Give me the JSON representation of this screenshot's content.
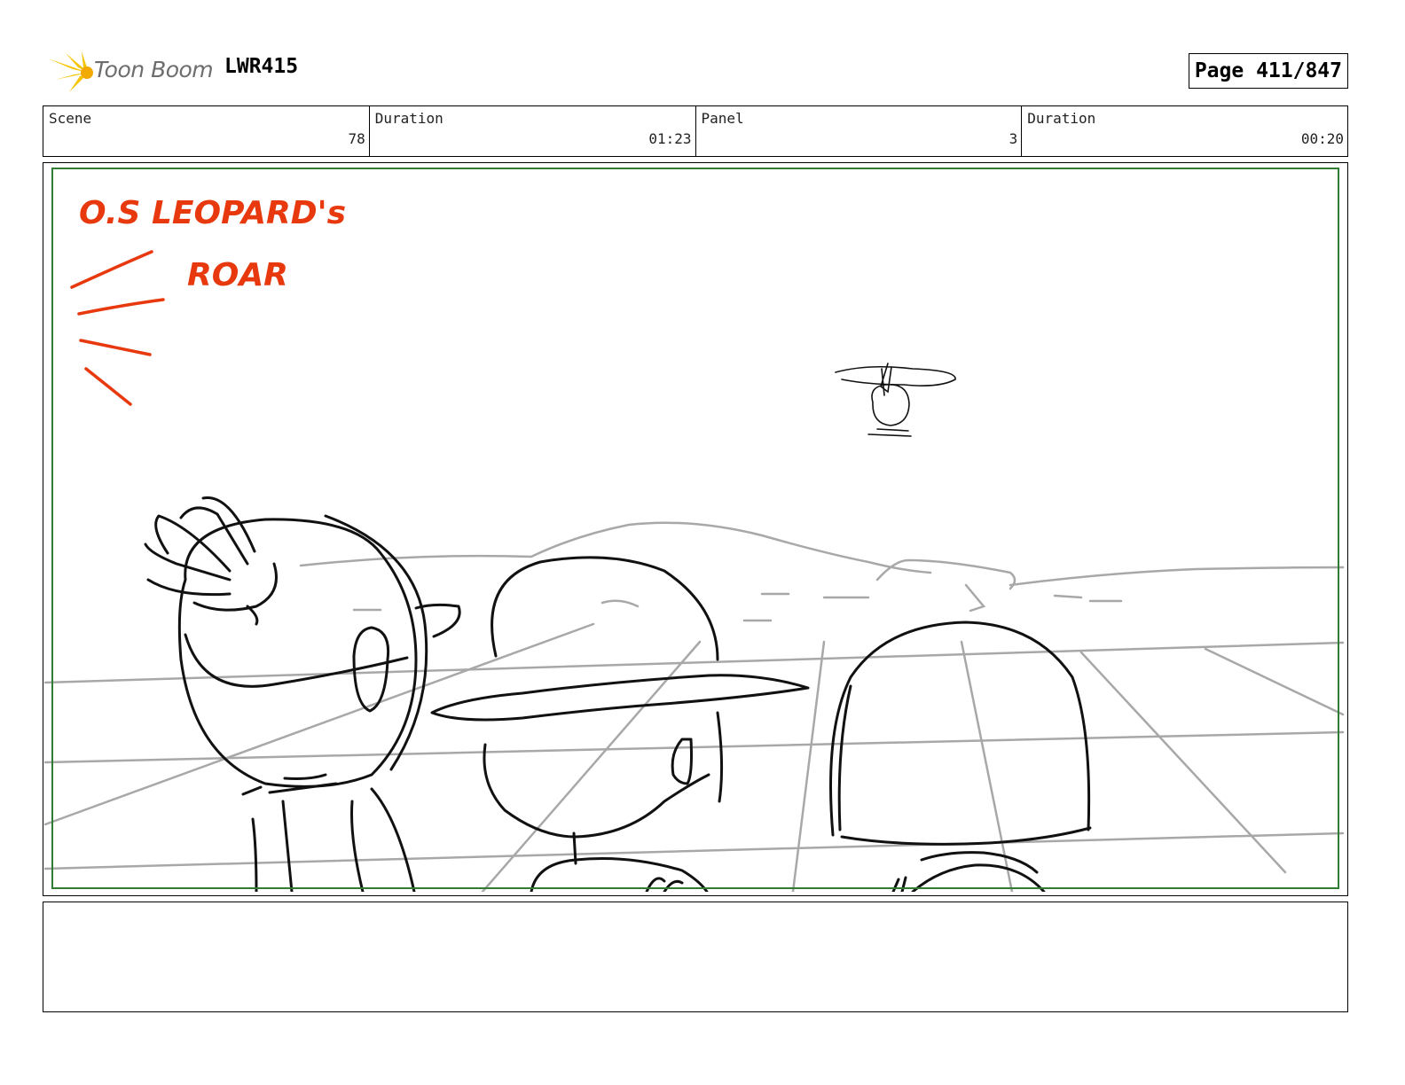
{
  "header": {
    "logo_text": "Toon Boom",
    "project_id": "LWR415",
    "page_label": "Page 411/847"
  },
  "info": [
    {
      "label": "Scene",
      "value": "78"
    },
    {
      "label": "Duration",
      "value": "01:23"
    },
    {
      "label": "Panel",
      "value": "3"
    },
    {
      "label": "Duration",
      "value": "00:20"
    }
  ],
  "panel": {
    "annotation_line1": "O.S LEOPARD's",
    "annotation_line2": "ROAR"
  },
  "colors": {
    "annotation": "#e8390e",
    "safe_frame": "#2f7d32",
    "sketch_line": "#111111",
    "background_line": "#a8a8a8",
    "logo_burst": "#f5c400"
  },
  "notes": ""
}
